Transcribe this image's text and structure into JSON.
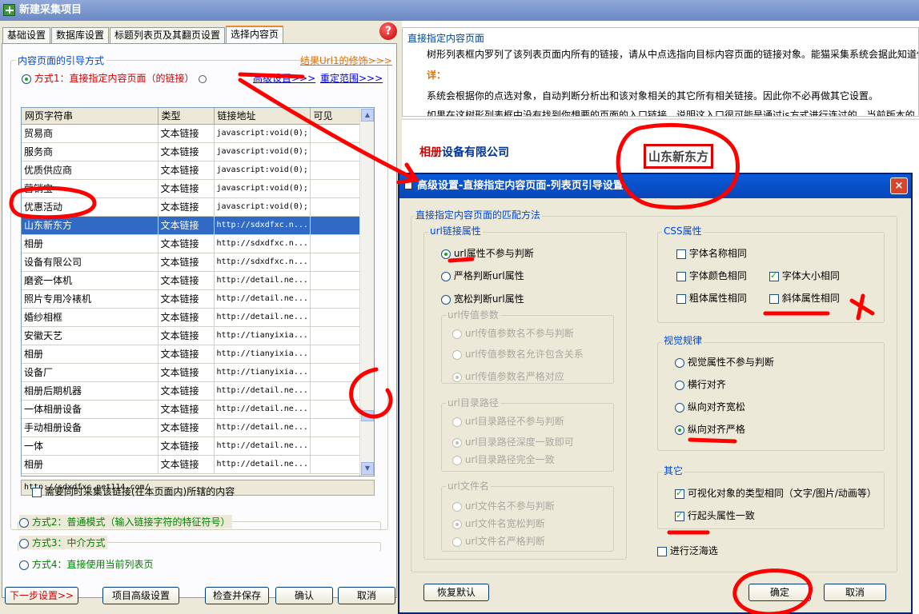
{
  "window": {
    "title": "新建采集项目"
  },
  "tabs": [
    "基础设置",
    "数据库设置",
    "标题列表页及其翻页设置",
    "选择内容页"
  ],
  "left": {
    "group_title": "内容页面的引导方式",
    "url_edit_link": "结果Url1的修饰>>>",
    "mode1_label": "方式1：直接指定内容页面（的链接）",
    "advanced_link": "高级设置>>>",
    "rescope_link": "重定范围>>>",
    "table": {
      "headers": [
        "网页字符串",
        "类型",
        "链接地址",
        "可见"
      ],
      "rows": [
        [
          "贸易商",
          "文本链接",
          "javascript:void(0);",
          ""
        ],
        [
          "服务商",
          "文本链接",
          "javascript:void(0);",
          ""
        ],
        [
          "优质供应商",
          "文本链接",
          "javascript:void(0);",
          ""
        ],
        [
          "营销宝",
          "文本链接",
          "javascript:void(0);",
          ""
        ],
        [
          "优惠活动",
          "文本链接",
          "javascript:void(0);",
          ""
        ],
        [
          "山东新东方",
          "文本链接",
          "http://sdxdfxc.n...",
          ""
        ],
        [
          "相册",
          "文本链接",
          "http://sdxdfxc.n...",
          ""
        ],
        [
          "设备有限公司",
          "文本链接",
          "http://sdxdfxc.n...",
          ""
        ],
        [
          "磨瓷一体机",
          "文本链接",
          "http://detail.ne...",
          ""
        ],
        [
          "照片专用冷裱机",
          "文本链接",
          "http://detail.ne...",
          ""
        ],
        [
          "婚纱相框",
          "文本链接",
          "http://detail.ne...",
          ""
        ],
        [
          "安徽天艺",
          "文本链接",
          "http://tianyixia...",
          ""
        ],
        [
          "相册",
          "文本链接",
          "http://tianyixia...",
          ""
        ],
        [
          "设备厂",
          "文本链接",
          "http://tianyixia...",
          ""
        ],
        [
          "相册后期机器",
          "文本链接",
          "http://detail.ne...",
          ""
        ],
        [
          "一体相册设备",
          "文本链接",
          "http://detail.ne...",
          ""
        ],
        [
          "手动相册设备",
          "文本链接",
          "http://detail.ne...",
          ""
        ],
        [
          "一体",
          "文本链接",
          "http://detail.ne...",
          ""
        ],
        [
          "相册",
          "文本链接",
          "http://detail.ne...",
          ""
        ]
      ],
      "selected_index": 5
    },
    "url_value": "http://sdxdfxc.net114.com/",
    "also_collect_label": "需要同时采集该链接(在本页面内)所辖的内容",
    "mode2_label": "方式2：普通模式（输入链接字符的特征符号）",
    "mode3_label": "方式3：中介方式",
    "mode4_label": "方式4：直接使用当前列表页",
    "buttons": {
      "next": "下一步设置>>",
      "project_adv": "项目高级设置",
      "check_save": "检查并保存",
      "ok": "确认",
      "cancel": "取消"
    }
  },
  "right": {
    "header": "直接指定内容页面",
    "line1": "树形列表框内罗列了该列表页面内所有的链接，请从中点选指向目标内容页面的链接对象。能猫采集系统会据此知道你",
    "detail_label": "详：",
    "line2": "系统会根据你的点选对象，自动判断分析出和该对象相关的其它所有相关链接。因此你不必再做其它设置。",
    "line3": "如果在这树形列表框中没有找到你想要的页面的入口链接，说明这入口很可能是通过js方式进行连过的，当前版本的",
    "preview_company_a": "相册",
    "preview_company_b": "设备有限公司",
    "preview_selected": "山东新东方"
  },
  "dialog": {
    "title": "高级设置-直接指定内容页面-列表页引导设置",
    "close": "×",
    "match_group": "直接指定内容页面的匹配方法",
    "url_group": "url链接属性",
    "url_opts": [
      "url属性不参与判断",
      "严格判断url属性",
      "宽松判断url属性"
    ],
    "param_group": "url传值参数",
    "param_opts": [
      "url传值参数名不参与判断",
      "url传值参数名允许包含关系",
      "url传值参数名严格对应"
    ],
    "dir_group": "url目录路径",
    "dir_opts": [
      "url目录路径不参与判断",
      "url目录路径深度一致即可",
      "url目录路径完全一致"
    ],
    "file_group": "url文件名",
    "file_opts": [
      "url文件名不参与判断",
      "url文件名宽松判断",
      "url文件名严格判断"
    ],
    "css_group": "CSS属性",
    "css_opts": [
      "字体名称相同",
      "字体大小相同",
      "字体颜色相同",
      "粗体属性相同",
      "斜体属性相同"
    ],
    "vis_group": "视觉规律",
    "vis_opts": [
      "视觉属性不参与判断",
      "横行对齐",
      "纵向对齐宽松",
      "纵向对齐严格"
    ],
    "other_group": "其它",
    "other_opts": [
      "可视化对象的类型相同（文字/图片/动画等）",
      "行起头属性一致"
    ],
    "flood_label": "进行泛海选",
    "btn_restore": "恢复默认",
    "btn_ok": "确定",
    "btn_cancel": "取消"
  },
  "colors": {
    "accent_red": "#ff0000",
    "selection": "#316ac5",
    "dialog_title": "#0a5ad8"
  }
}
